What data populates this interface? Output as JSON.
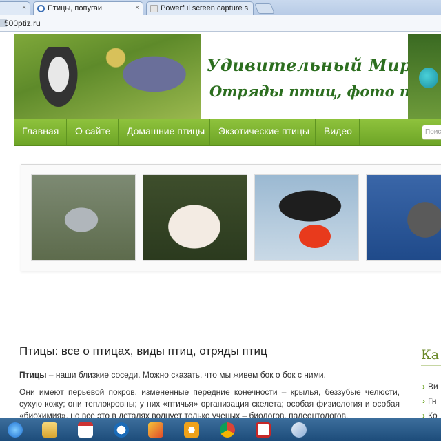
{
  "browser": {
    "tabs": [
      {
        "label": "",
        "active": false
      },
      {
        "label": "Птицы, попугаи",
        "active": true
      },
      {
        "label": "Powerful screen capture s",
        "active": false
      }
    ],
    "close_glyph": "×",
    "address": "500ptiz.ru"
  },
  "banner": {
    "title": "Удивительный Мир Птиц",
    "subtitle": "Отряды птиц, фото птиц"
  },
  "nav": {
    "items": [
      "Главная",
      "О сайте",
      "Домашние птицы",
      "Экзотические птицы",
      "Видео"
    ],
    "search_placeholder": "Поис"
  },
  "slider": {
    "images": [
      "heron-photo",
      "pelican-photo",
      "frigatebird-photo",
      "seabird-photo"
    ]
  },
  "article": {
    "title": "Птицы: все о птицах, виды птиц, отряды птиц",
    "p1_bold": "Птицы",
    "p1_rest": " – наши близкие соседи. Можно сказать, что мы живем бок о бок с ними.",
    "p2": "Они имеют перьевой покров, измененные передние конечности – крылья, беззубые челюсти, сухую кожу; они теплокровны; у них «птичья» организация скелета; особая физиология и особая «биохимия», но все это в деталях волнует только ученых – биологов, палеонтологов,"
  },
  "sidebar": {
    "title": "Ка",
    "items": [
      "Ви",
      "Гн",
      "Ко"
    ]
  },
  "taskbar": {
    "icons": [
      "ie-icon",
      "explorer-icon",
      "calendar-icon",
      "hp-icon",
      "cards-icon",
      "mail-icon",
      "chrome-icon",
      "screenshot-tool-icon",
      "paint-icon"
    ]
  },
  "colors": {
    "accent_green": "#7ab32e",
    "title_green": "#2c6e1f"
  }
}
